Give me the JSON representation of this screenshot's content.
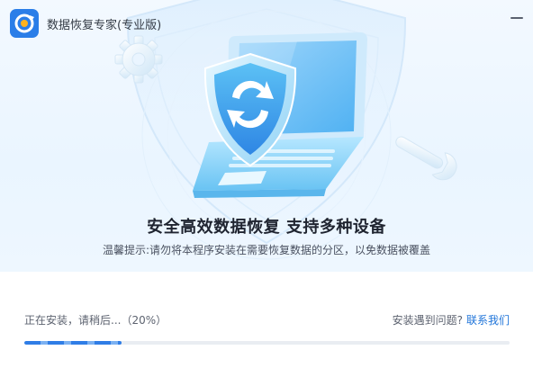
{
  "window": {
    "title": "数据恢复专家(专业版)",
    "icon": "app-logo-icon",
    "close_icon": "minimize-icon"
  },
  "hero": {
    "illustration": [
      "shield-sync-icon",
      "laptop-illustration",
      "gear-icon",
      "wrench-icon"
    ],
    "headline": "安全高效数据恢复 支持多种设备",
    "tip": "温馨提示:请勿将本程序安装在需要恢复数据的分区，以免数据被覆盖"
  },
  "install": {
    "status_text": "正在安装，请稍后...（20%）",
    "progress_percent": 20,
    "help_prompt": "安装遇到问题?",
    "help_link": "联系我们"
  },
  "colors": {
    "accent": "#2f7de6",
    "link": "#1f74d9",
    "hero_bg": "#eaf5ff"
  }
}
